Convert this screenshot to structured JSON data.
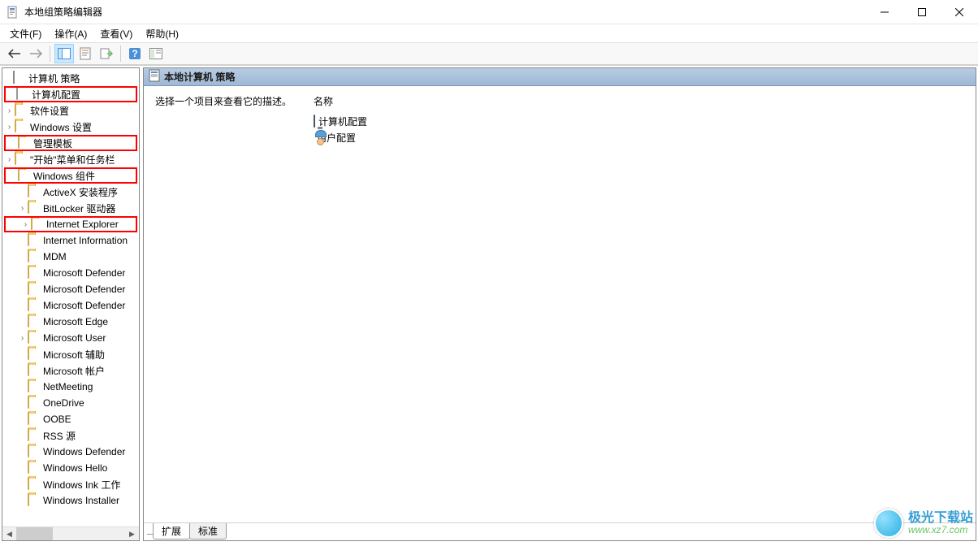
{
  "window": {
    "title": "本地组策略编辑器"
  },
  "menu": {
    "file": "文件(F)",
    "operation": "操作(A)",
    "view": "查看(V)",
    "help": "帮助(H)"
  },
  "tree": {
    "root": "计算机 策略",
    "computer_config": "计算机配置",
    "software_settings": "软件设置",
    "windows_settings": "Windows 设置",
    "admin_templates": "管理模板",
    "start_menu": "\"开始\"菜单和任务栏",
    "windows_components": "Windows 组件",
    "items": [
      "ActiveX 安装程序",
      "BitLocker 驱动器",
      "Internet Explorer",
      "Internet Information",
      "MDM",
      "Microsoft Defender",
      "Microsoft Defender",
      "Microsoft Defender",
      "Microsoft Edge",
      "Microsoft User",
      "Microsoft 辅助",
      "Microsoft 帐户",
      "NetMeeting",
      "OneDrive",
      "OOBE",
      "RSS 源",
      "Windows Defender",
      "Windows Hello",
      "Windows Ink 工作",
      "Windows Installer"
    ]
  },
  "content": {
    "header": "本地计算机 策略",
    "hint": "选择一个项目来查看它的描述。",
    "name_col": "名称",
    "items": {
      "computer": "计算机配置",
      "user": "用户配置"
    }
  },
  "tabs": {
    "extended": "扩展",
    "standard": "标准"
  },
  "watermark": {
    "name": "极光下载站",
    "url": "www.xz7.com"
  }
}
